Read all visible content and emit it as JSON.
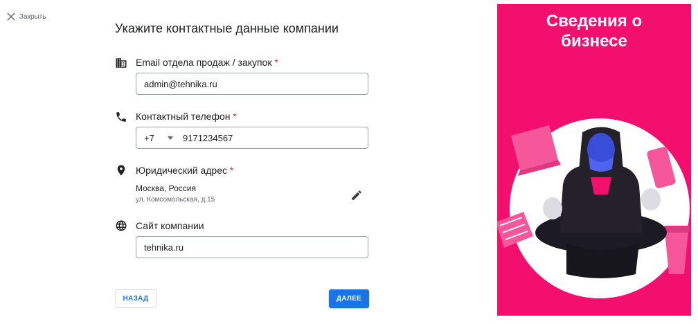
{
  "close": {
    "label": "Закрыть",
    "icon": "close-icon"
  },
  "heading": "Укажите контактные данные компании",
  "email": {
    "icon": "building-icon",
    "label": "Email отдела продаж / закупок",
    "required_mark": "*",
    "value": "admin@tehnika.ru"
  },
  "phone": {
    "icon": "phone-icon",
    "label": "Контактный телефон",
    "required_mark": "*",
    "country_code": "+7",
    "value": "9171234567"
  },
  "address": {
    "icon": "location-pin-icon",
    "label": "Юридический адрес",
    "required_mark": "*",
    "line1": "Москва, Россия",
    "line2": "ул. Комсомольская, д.15",
    "edit_icon": "pencil-icon"
  },
  "website": {
    "icon": "globe-icon",
    "label": "Сайт компании",
    "value": "tehnika.ru"
  },
  "buttons": {
    "back": "НАЗАД",
    "next": "ДАЛЕЕ"
  },
  "promo": {
    "title_line1": "Сведения о",
    "title_line2": "бизнесе",
    "background": "#f20f6e"
  },
  "colors": {
    "accent": "#1a73e8",
    "required": "#d93025"
  }
}
